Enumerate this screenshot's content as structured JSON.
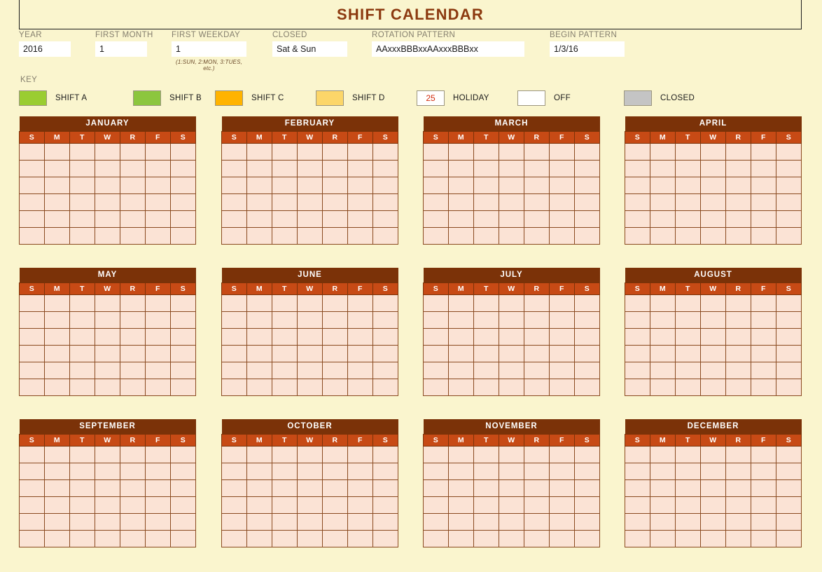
{
  "title": "SHIFT CALENDAR",
  "settings": [
    {
      "label": "YEAR",
      "value": "2016",
      "hint": ""
    },
    {
      "label": "FIRST MONTH",
      "value": "1",
      "hint": ""
    },
    {
      "label": "FIRST WEEKDAY",
      "value": "1",
      "hint": "(1:SUN, 2:MON, 3:TUES, etc.)"
    },
    {
      "label": "CLOSED",
      "value": "Sat & Sun",
      "hint": ""
    },
    {
      "label": "ROTATION PATTERN",
      "value": "AAxxxBBBxxAAxxxBBBxx",
      "hint": ""
    },
    {
      "label": "BEGIN PATTERN",
      "value": "1/3/16",
      "hint": ""
    }
  ],
  "key": {
    "title": "KEY",
    "items": [
      {
        "label": "SHIFT A",
        "color": "#9ACD32",
        "text": ""
      },
      {
        "label": "SHIFT B",
        "color": "#8CC63E",
        "text": ""
      },
      {
        "label": "SHIFT C",
        "color": "#FFB300",
        "text": ""
      },
      {
        "label": "SHIFT D",
        "color": "#FCD669",
        "text": ""
      },
      {
        "label": "HOLIDAY",
        "color": "#FFFFFF",
        "text": "25"
      },
      {
        "label": "OFF",
        "color": "#FFFFFF",
        "text": ""
      },
      {
        "label": "CLOSED",
        "color": "#C4C4C4",
        "text": ""
      }
    ]
  },
  "weekdays": [
    "S",
    "M",
    "T",
    "W",
    "R",
    "F",
    "S"
  ],
  "months": [
    "JANUARY",
    "FEBRUARY",
    "MARCH",
    "APRIL",
    "MAY",
    "JUNE",
    "JULY",
    "AUGUST",
    "SEPTEMBER",
    "OCTOBER",
    "NOVEMBER",
    "DECEMBER"
  ],
  "grid": {
    "rows": 6,
    "cols": 7,
    "cells_empty": true
  },
  "colors": {
    "page_background": "#FAF5CE",
    "title_text": "#8C3A10",
    "month_header": "#7B3208",
    "weekday_header": "#C74A15",
    "day_cell": "#FBE3D5",
    "cell_border": "#8A4A20",
    "label_text": "#857F6E",
    "holiday_text": "#D22B0C"
  }
}
